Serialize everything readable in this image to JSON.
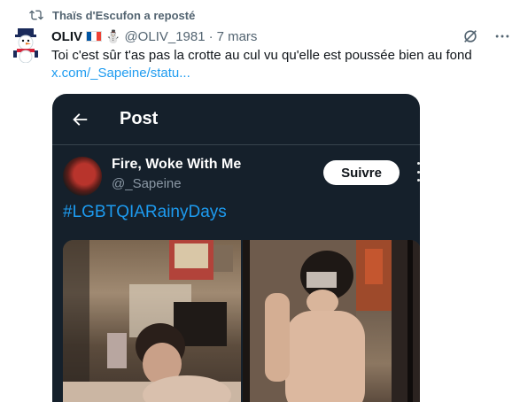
{
  "repost": {
    "label": "Thaïs d'Escufon a reposté"
  },
  "tweet": {
    "author_name": "OLIV",
    "flag_colors": [
      "#0055a4",
      "#ffffff",
      "#ef4135"
    ],
    "emoji": "⛄",
    "handle": "@OLIV_1981",
    "separator": "·",
    "date": "7 mars",
    "text": "Toi c'est sûr t'as pas la crotte au cul vu qu'elle est poussée bien au fond",
    "link": "x.com/_Sapeine/statu..."
  },
  "embed": {
    "header_title": "Post",
    "author_name": "Fire, Woke With Me",
    "author_handle": "@_Sapeine",
    "follow_label": "Suivre",
    "hashtag": "#LGBTQIARainyDays",
    "background": "#15202b",
    "accent": "#1d9bf0"
  }
}
